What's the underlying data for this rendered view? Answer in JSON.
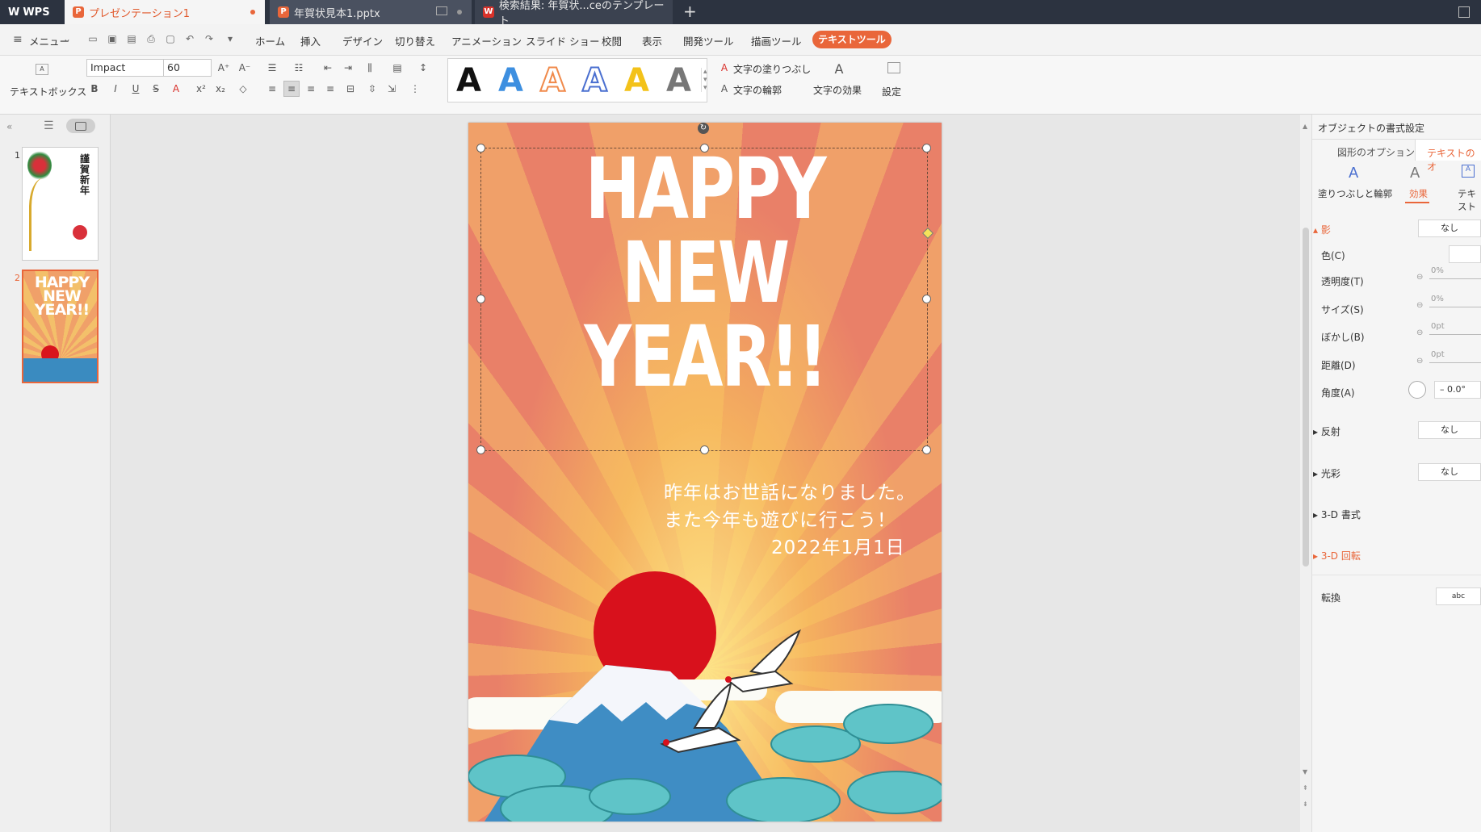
{
  "titlebar": {
    "app": "WPS",
    "tabs": [
      {
        "label": "プレゼンテーション1"
      },
      {
        "label": "年賀状見本1.pptx"
      },
      {
        "label": "検索結果: 年賀状...ceのテンプレート"
      }
    ],
    "new_tab": "+"
  },
  "menubar": {
    "menu_label": "メニュー",
    "items": [
      "ホーム",
      "挿入",
      "デザイン",
      "切り替え",
      "アニメーション",
      "スライド ショー",
      "校閲",
      "表示",
      "開発ツール",
      "描画ツール"
    ],
    "active_tool": "テキストツール"
  },
  "ribbon": {
    "textbox_label": "テキストボックス",
    "font_name": "Impact",
    "font_size": "60",
    "wordart_letter": "A",
    "wordart_colors": [
      "#111111",
      "#3d8fe0",
      "#f08a4b",
      "#4a6fd0",
      "#f3c21a",
      "#777777"
    ],
    "fill_label": "文字の塗りつぶし",
    "outline_label": "文字の輪郭",
    "effect_label": "文字の効果",
    "settings_label": "設定"
  },
  "thumbnails": [
    {
      "num": "1",
      "title": "謹賀新年"
    },
    {
      "num": "2",
      "title": "HAPPY NEW YEAR!!"
    }
  ],
  "slide": {
    "headline": [
      "HAPPY",
      "NEW",
      "YEAR!!"
    ],
    "greeting": [
      "昨年はお世話になりました。",
      "また今年も遊びに行こう！",
      "2022年1月1日"
    ]
  },
  "panel": {
    "title": "オブジェクトの書式設定",
    "tab_shape": "図形のオプション",
    "tab_text": "テキストのオ",
    "subtab_fill": "塗りつぶしと輪郭",
    "subtab_effect": "効果",
    "subtab_text": "テキスト",
    "shadow": "影",
    "shadow_value": "なし",
    "color": "色(C)",
    "transparency": "透明度(T)",
    "transparency_value": "0%",
    "size": "サイズ(S)",
    "size_value": "0%",
    "blur": "ぼかし(B)",
    "blur_value": "0pt",
    "distance": "距離(D)",
    "distance_value": "0pt",
    "angle": "角度(A)",
    "angle_value": "0.0°",
    "reflection": "反射",
    "reflection_value": "なし",
    "glow": "光彩",
    "glow_value": "なし",
    "format3d": "3-D 書式",
    "rotation3d": "3-D 回転",
    "transform": "転換",
    "transform_value": "abc"
  }
}
